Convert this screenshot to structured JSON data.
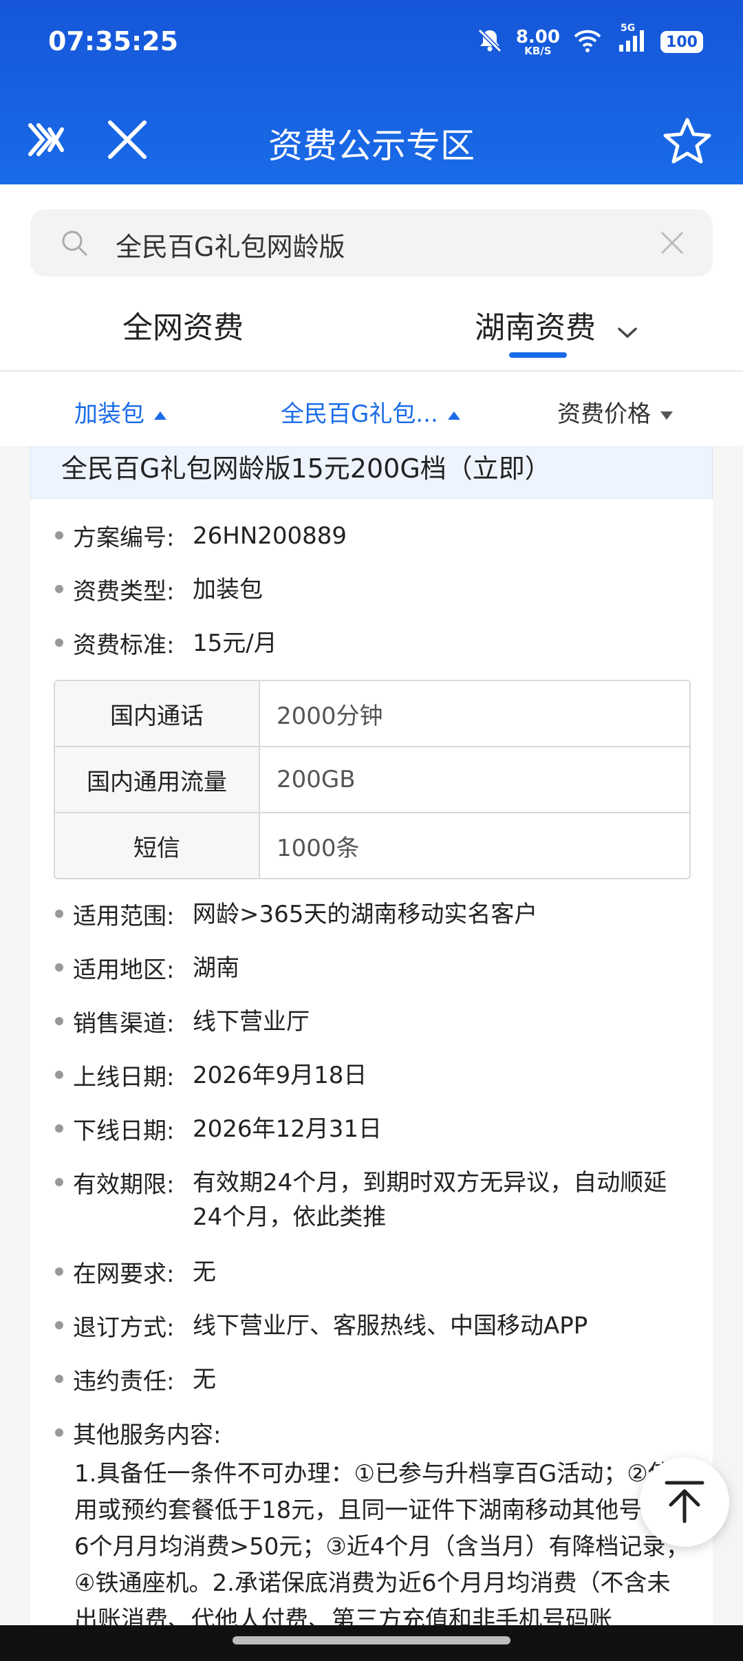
{
  "status_bar": {
    "time": "07:35:25",
    "net_speed_value": "8.00",
    "net_speed_unit": "KB/S",
    "network_type": "5G",
    "battery": "100"
  },
  "nav": {
    "title": "资费公示专区"
  },
  "search": {
    "query": "全民百G礼包网龄版"
  },
  "tabs": [
    {
      "label": "全网资费"
    },
    {
      "label": "湖南资费"
    }
  ],
  "filters": [
    {
      "label": "加装包",
      "active": true
    },
    {
      "label": "全民百G礼包...",
      "active": true
    },
    {
      "label": "资费价格",
      "active": false
    }
  ],
  "colors": {
    "brand_blue": "#1a6be8",
    "header_blue": "#1556d8"
  },
  "plan": {
    "title": "全民百G礼包网龄版15元200G档（立即）",
    "fields": [
      {
        "label": "方案编号:",
        "value": "26HN200889"
      },
      {
        "label": "资费类型:",
        "value": "加装包"
      },
      {
        "label": "资费标准:",
        "value": "15元/月"
      }
    ],
    "table": [
      {
        "key": "国内通话",
        "value": "2000分钟"
      },
      {
        "key": "国内通用流量",
        "value": "200GB"
      },
      {
        "key": "短信",
        "value": "1000条"
      }
    ],
    "fields2": [
      {
        "label": "适用范围:",
        "value": "网龄>365天的湖南移动实名客户"
      },
      {
        "label": "适用地区:",
        "value": "湖南"
      },
      {
        "label": "销售渠道:",
        "value": "线下营业厅"
      },
      {
        "label": "上线日期:",
        "value": "2026年9月18日"
      },
      {
        "label": "下线日期:",
        "value": "2026年12月31日"
      },
      {
        "label": "有效期限:",
        "value": "有效期24个月，到期时双方无异议，自动顺延24个月，依此类推"
      },
      {
        "label": "在网要求:",
        "value": "无"
      },
      {
        "label": "退订方式:",
        "value": "线下营业厅、客服热线、中国移动APP"
      },
      {
        "label": "违约责任:",
        "value": "无"
      }
    ],
    "other_label": "其他服务内容:",
    "other_text": "1.具备任一条件不可办理：①已参与升档享百G活动；②使用或预约套餐低于18元，且同一证件下湖南移动其他号码近6个月月均消费>50元；③近4个月（含当月）有降档记录；④铁通座机。2.承诺保底消费为近6个月月均消费（不含未出账消费、代他人付费、第三方充值和非手机号码账"
  }
}
